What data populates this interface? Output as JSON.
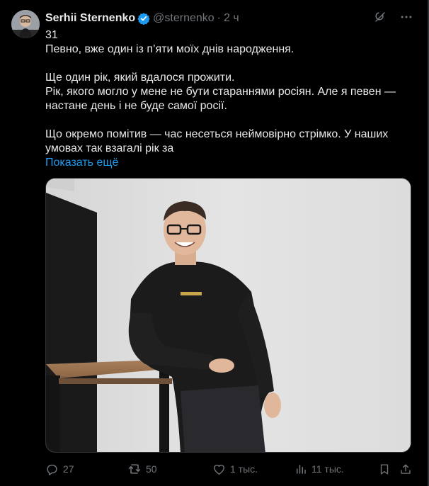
{
  "author": {
    "name": "Serhii Sternenko",
    "handle": "@sternenko",
    "time": "2 ч"
  },
  "tweet": {
    "lines": [
      "31",
      "Певно, вже один із п’яти моїх днів народження."
    ],
    "paragraph2": [
      "Ще один рік, який вдалося прожити.",
      "Рік, якого могло у мене не бути стараннями росіян. Але я певен — настане день і не буде самої росії."
    ],
    "paragraph3": "Що окремо помітив — час несеться неймовірно стрімко. У наших умовах так взагалі рік за",
    "show_more": "Показать ещё"
  },
  "stats": {
    "replies": "27",
    "reposts": "50",
    "likes": "1 тыс.",
    "views": "11 тыс."
  },
  "colors": {
    "background": "#000000",
    "text": "#e7e9ea",
    "muted": "#71767b",
    "link": "#1d9bf0",
    "verified": "#1d9bf0"
  },
  "icons": {
    "verified": "verified-badge-icon",
    "grok": "grok-icon",
    "more": "more-icon",
    "reply": "reply-icon",
    "repost": "repost-icon",
    "like": "like-icon",
    "views": "views-icon",
    "bookmark": "bookmark-icon",
    "share": "share-icon"
  }
}
